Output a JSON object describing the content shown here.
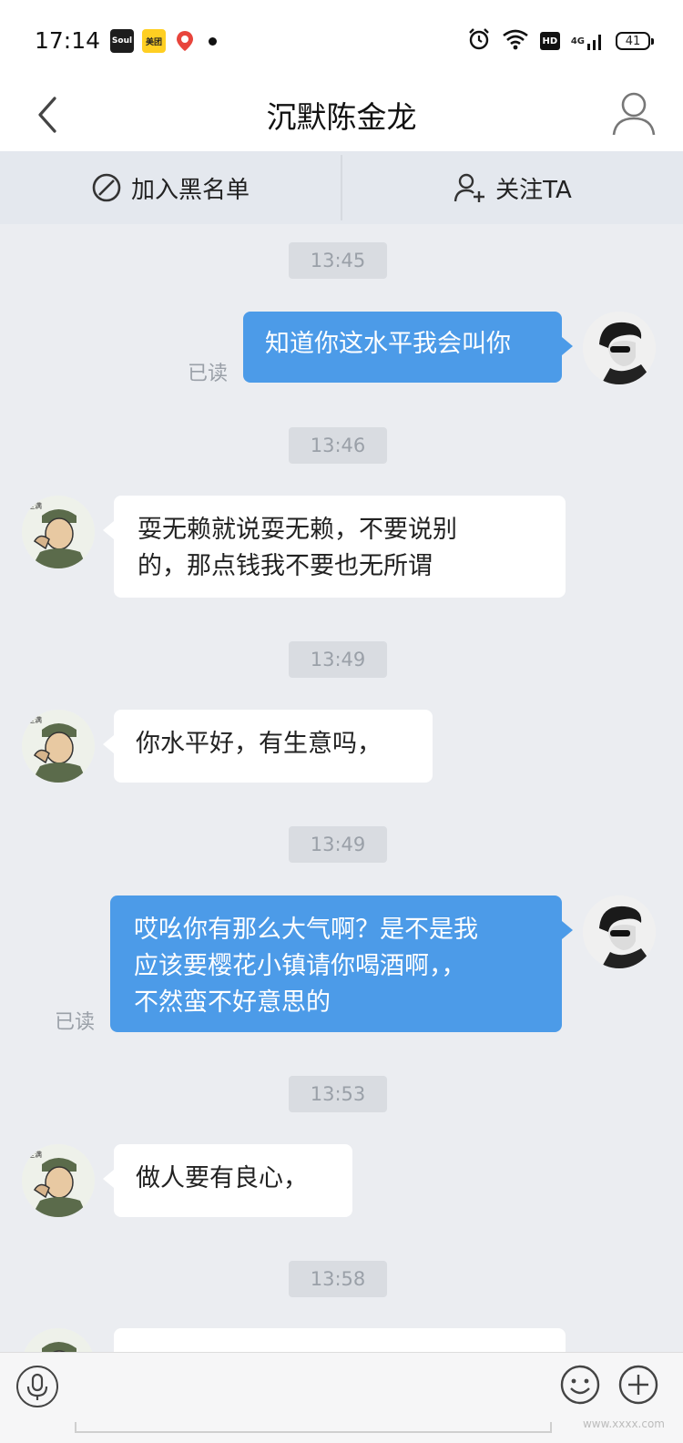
{
  "status_bar": {
    "time": "17:14",
    "app_badges": [
      "Soul",
      "美团"
    ],
    "network": "4G",
    "hd": "HD",
    "battery": "41"
  },
  "header": {
    "title": "沉默陈金龙"
  },
  "actions": {
    "block_label": "加入黑名单",
    "follow_label": "关注TA"
  },
  "messages": [
    {
      "type": "time",
      "text": "13:45"
    },
    {
      "type": "out",
      "text": "知道你这水平我会叫你",
      "read": "已读"
    },
    {
      "type": "time",
      "text": "13:46"
    },
    {
      "type": "in",
      "lines": [
        "耍无赖就说耍无赖，不要说别",
        "的，那点钱我不要也无所谓"
      ]
    },
    {
      "type": "time",
      "text": "13:49"
    },
    {
      "type": "in",
      "lines": [
        "你水平好，有生意吗，"
      ]
    },
    {
      "type": "time",
      "text": "13:49"
    },
    {
      "type": "out",
      "lines": [
        "哎吆你有那么大气啊？是不是我",
        "应该要樱花小镇请你喝酒啊，，",
        "不然蛮不好意思的"
      ],
      "read": "已读"
    },
    {
      "type": "time",
      "text": "13:53"
    },
    {
      "type": "in",
      "lines": [
        "做人要有良心，"
      ]
    },
    {
      "type": "time",
      "text": "13:58"
    }
  ],
  "watermark": "www.xxxx.com",
  "colors": {
    "outgoing_bubble": "#4c9be8",
    "incoming_bubble": "#ffffff",
    "chat_background": "#ebedf1",
    "action_bar": "#e4e8ee"
  },
  "icons": [
    "back-arrow-icon",
    "user-profile-icon",
    "block-icon",
    "follow-user-icon",
    "microphone-icon",
    "emoji-icon",
    "plus-icon",
    "alarm-icon",
    "wifi-icon",
    "signal-icon"
  ]
}
